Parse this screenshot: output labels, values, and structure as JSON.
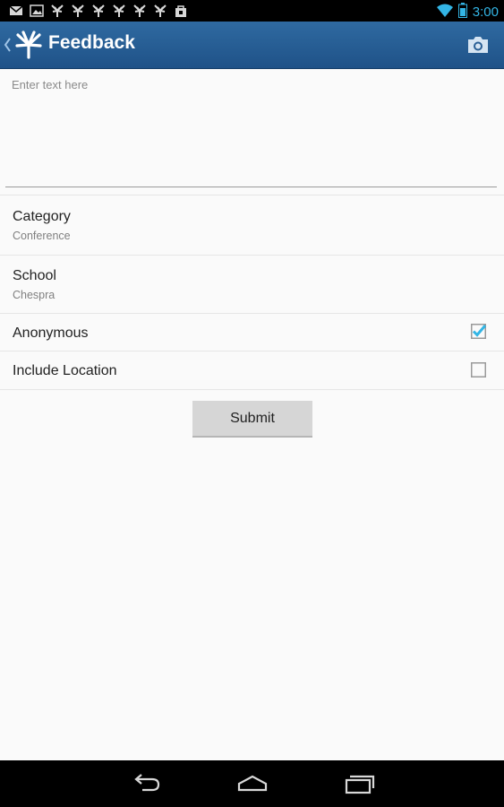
{
  "status_bar": {
    "time": "3:00",
    "icons": [
      "gmail-icon",
      "picture-icon",
      "app-notification-icon",
      "app-notification-icon",
      "app-notification-icon",
      "app-notification-icon",
      "app-notification-icon",
      "app-notification-icon",
      "store-icon",
      "wifi-icon",
      "battery-icon"
    ],
    "time_color": "#33b5e5"
  },
  "action_bar": {
    "title": "Feedback",
    "background": "#2a5f95",
    "icons": [
      "up-caret-icon",
      "app-logo-icon",
      "camera-icon"
    ]
  },
  "feedback": {
    "placeholder": "Enter text here",
    "value": ""
  },
  "options": {
    "category": {
      "label": "Category",
      "value": "Conference"
    },
    "school": {
      "label": "School",
      "value": "Chespra"
    },
    "anonymous": {
      "label": "Anonymous",
      "checked": true
    },
    "include_location": {
      "label": "Include Location",
      "checked": false
    }
  },
  "submit_label": "Submit",
  "accent_color": "#33b5e5",
  "nav_bar": {
    "icons": [
      "back-icon",
      "home-icon",
      "recent-apps-icon"
    ]
  }
}
